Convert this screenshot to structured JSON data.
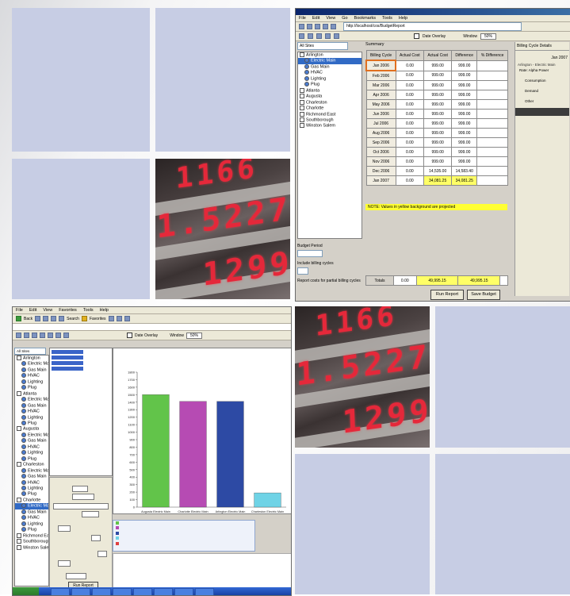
{
  "colors": {
    "tile": "#c7cde4",
    "led_red": "#e5283a",
    "highlight_yellow": "#ffff66",
    "bar_green": "#62c44a",
    "bar_magenta": "#b64bb3",
    "bar_blue": "#2d4aa4",
    "bar_cyan": "#6fd3e6"
  },
  "display_panels": {
    "top": {
      "line1": "1166",
      "line2": "1.5227",
      "line3": "1299"
    },
    "bottom": {
      "line1": "1166",
      "line2": "1.5227",
      "line3": "1299"
    }
  },
  "budget_window": {
    "menu": [
      "File",
      "Edit",
      "View",
      "Go",
      "Bookmarks",
      "Tools",
      "Help"
    ],
    "address": "http://localhost/cos/BudgetReport",
    "toolbar": {
      "date_label": "Date Overlay",
      "window_label": "Window",
      "window_value": "50%"
    },
    "scope_value": "All Sites",
    "tree": [
      {
        "label": "Arlington",
        "level": 0
      },
      {
        "label": "Electric Main",
        "level": 1,
        "selected": true
      },
      {
        "label": "Gas Main",
        "level": 1
      },
      {
        "label": "HVAC",
        "level": 1
      },
      {
        "label": "Lighting",
        "level": 1
      },
      {
        "label": "Plug",
        "level": 1
      },
      {
        "label": "Atlanta",
        "level": 0
      },
      {
        "label": "Augusta",
        "level": 0
      },
      {
        "label": "Charleston",
        "level": 0
      },
      {
        "label": "Charlotte",
        "level": 0
      },
      {
        "label": "Richmond East",
        "level": 0
      },
      {
        "label": "Southborough",
        "level": 0
      },
      {
        "label": "Winston Salem",
        "level": 0
      }
    ],
    "left_fields": {
      "budget_label": "Budget Period",
      "cycles_label": "Include billing cycles",
      "option_label": "Report costs for partial billing cycles"
    },
    "summary_label": "Summary",
    "table": {
      "headers": [
        "Billing Cycle",
        "Actual Cost",
        "Actual Cost",
        "Difference",
        "% Difference"
      ],
      "rows": [
        {
          "month": "Jan 2006",
          "a": "0.00",
          "b": "999.00",
          "c": "999.00",
          "d": ""
        },
        {
          "month": "Feb 2006",
          "a": "0.00",
          "b": "999.00",
          "c": "999.00",
          "d": ""
        },
        {
          "month": "Mar 2006",
          "a": "0.00",
          "b": "999.00",
          "c": "999.00",
          "d": ""
        },
        {
          "month": "Apr 2006",
          "a": "0.00",
          "b": "999.00",
          "c": "999.00",
          "d": ""
        },
        {
          "month": "May 2006",
          "a": "0.00",
          "b": "999.00",
          "c": "999.00",
          "d": ""
        },
        {
          "month": "Jun 2006",
          "a": "0.00",
          "b": "999.00",
          "c": "999.00",
          "d": ""
        },
        {
          "month": "Jul 2006",
          "a": "0.00",
          "b": "999.00",
          "c": "999.00",
          "d": ""
        },
        {
          "month": "Aug 2006",
          "a": "0.00",
          "b": "999.00",
          "c": "999.00",
          "d": ""
        },
        {
          "month": "Sep 2006",
          "a": "0.00",
          "b": "999.00",
          "c": "999.00",
          "d": ""
        },
        {
          "month": "Oct 2006",
          "a": "0.00",
          "b": "999.00",
          "c": "999.00",
          "d": ""
        },
        {
          "month": "Nov 2006",
          "a": "0.00",
          "b": "999.00",
          "c": "999.00",
          "d": ""
        },
        {
          "month": "Dec 2006",
          "a": "0.00",
          "b": "14,535.00",
          "c": "14,583.40",
          "d": ""
        },
        {
          "month": "Jan 2007",
          "a": "0.00",
          "b": "34,081.25",
          "c": "34,081.25",
          "d": "",
          "highlight": true
        }
      ],
      "note": "NOTE: Values in yellow background are projected",
      "totals": {
        "label": "Totals",
        "a": "0.00",
        "b": "49,995.15",
        "c": "49,995.15"
      }
    },
    "buttons": {
      "run": "Run Report",
      "save": "Save Budget"
    },
    "detail_panel": {
      "title": "Billing Cycle Details",
      "lines": [
        "Jan 2007",
        "Arlington - Electric Main",
        "Rate: Alpha Power",
        "Consumption",
        "Demand",
        "Other"
      ]
    }
  },
  "chart_window": {
    "menu": [
      "File",
      "Edit",
      "View",
      "Favorites",
      "Tools",
      "Help"
    ],
    "toolbar_buttons": [
      "Back",
      "Search",
      "Favorites"
    ],
    "toolbar": {
      "date_label": "Date Overlay",
      "window_label": "Window",
      "window_value": "50%"
    },
    "scope_value": "All Sites",
    "tree": [
      {
        "label": "Arlington",
        "level": 0
      },
      {
        "label": "Electric Main",
        "level": 1
      },
      {
        "label": "Gas Main",
        "level": 1
      },
      {
        "label": "HVAC",
        "level": 1
      },
      {
        "label": "Lighting",
        "level": 1
      },
      {
        "label": "Plug",
        "level": 1
      },
      {
        "label": "Atlanta",
        "level": 0
      },
      {
        "label": "Electric Main",
        "level": 1
      },
      {
        "label": "Gas Main",
        "level": 1
      },
      {
        "label": "HVAC",
        "level": 1
      },
      {
        "label": "Lighting",
        "level": 1
      },
      {
        "label": "Plug",
        "level": 1
      },
      {
        "label": "Augusta",
        "level": 0
      },
      {
        "label": "Electric Main",
        "level": 1
      },
      {
        "label": "Gas Main",
        "level": 1
      },
      {
        "label": "HVAC",
        "level": 1
      },
      {
        "label": "Lighting",
        "level": 1
      },
      {
        "label": "Plug",
        "level": 1
      },
      {
        "label": "Charleston",
        "level": 0
      },
      {
        "label": "Electric Main",
        "level": 1
      },
      {
        "label": "Gas Main",
        "level": 1
      },
      {
        "label": "HVAC",
        "level": 1
      },
      {
        "label": "Lighting",
        "level": 1
      },
      {
        "label": "Plug",
        "level": 1
      },
      {
        "label": "Charlotte",
        "level": 0
      },
      {
        "label": "Electric Main",
        "level": 1,
        "selected": true
      },
      {
        "label": "Gas Main",
        "level": 1
      },
      {
        "label": "HVAC",
        "level": 1
      },
      {
        "label": "Lighting",
        "level": 1
      },
      {
        "label": "Plug",
        "level": 1
      },
      {
        "label": "Richmond East",
        "level": 0
      },
      {
        "label": "Southborough",
        "level": 0
      },
      {
        "label": "Winston Salem",
        "level": 0
      }
    ],
    "run_button": "Run Report"
  },
  "chart_data": {
    "type": "bar",
    "title": "",
    "subtitle": "",
    "xlabel": "",
    "ylabel": "",
    "categories": [
      "Augusta  Electric Main",
      "Charlotte  Electric Main",
      "Arlington  Electric Main",
      "Charleston  Electric Main"
    ],
    "values": [
      1500,
      1410,
      1410,
      190
    ],
    "value_labels": [
      "",
      "",
      "",
      ""
    ],
    "bar_colors": [
      "#62c44a",
      "#b64bb3",
      "#2d4aa4",
      "#6fd3e6"
    ],
    "ylim": [
      0,
      1800
    ],
    "yticks": [
      0,
      100,
      200,
      300,
      400,
      500,
      600,
      700,
      800,
      900,
      1000,
      1100,
      1200,
      1300,
      1400,
      1500,
      1600,
      1700,
      1800
    ],
    "grid": false,
    "legend": "bottom"
  }
}
